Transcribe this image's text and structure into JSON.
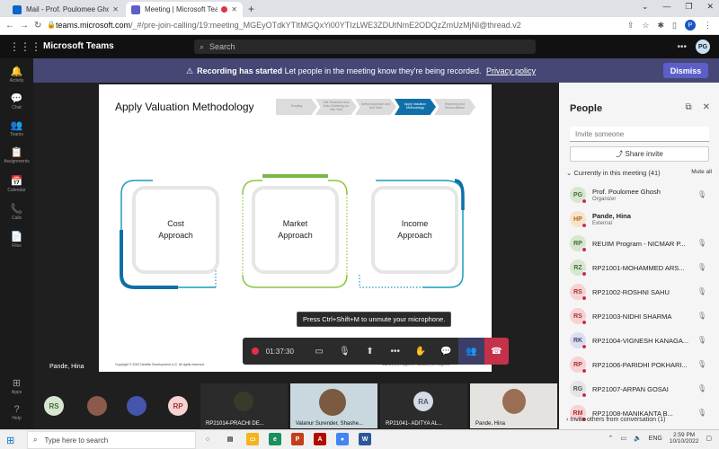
{
  "browser": {
    "tabs": [
      {
        "title": "Mail - Prof. Poulomee Ghosh - O",
        "active": false
      },
      {
        "title": "Meeting | Microsoft Teams",
        "active": true
      }
    ],
    "url_host": "teams.microsoft.com",
    "url_path": "/_#/pre-join-calling/19:meeting_MGEyOTdkYTItMGQxYi00YTIzLWE3ZDUtNmE2ODQzZmUzMjNl@thread.v2",
    "profile_initial": "P"
  },
  "teams": {
    "app_name": "Microsoft Teams",
    "search_placeholder": "Search",
    "user_initials": "PG"
  },
  "rail": [
    {
      "icon": "bell-icon",
      "glyph": "🔔",
      "label": "Activity"
    },
    {
      "icon": "chat-icon",
      "glyph": "💬",
      "label": "Chat"
    },
    {
      "icon": "teams-icon",
      "glyph": "👥",
      "label": "Teams"
    },
    {
      "icon": "assignments-icon",
      "glyph": "📋",
      "label": "Assignments"
    },
    {
      "icon": "calendar-icon",
      "glyph": "📅",
      "label": "Calendar"
    },
    {
      "icon": "calls-icon",
      "glyph": "📞",
      "label": "Calls"
    },
    {
      "icon": "files-icon",
      "glyph": "📄",
      "label": "Files"
    },
    {
      "icon": "apps-icon",
      "glyph": "⊞",
      "label": "Apps"
    },
    {
      "icon": "help-icon",
      "glyph": "?",
      "label": "Help"
    }
  ],
  "banner": {
    "bold": "Recording has started",
    "text": "Let people in the meeting know they're being recorded.",
    "link": "Privacy policy",
    "dismiss": "Dismiss"
  },
  "slide": {
    "title": "Apply Valuation Methodology",
    "steps": [
      "Scoping",
      "Site Research and Data Gathering on Site Visit",
      "Select Approach and Use Data",
      "Apply Valuation Methodology",
      "Reporting and Reconciliation"
    ],
    "approaches": [
      {
        "line1": "Cost",
        "line2": "Approach",
        "color": "#0f6fa8"
      },
      {
        "line1": "Market",
        "line2": "Approach",
        "color": "#8cc63f"
      },
      {
        "line1": "Income",
        "line2": "Approach",
        "color": "#1a9ac0"
      }
    ],
    "footer_left": "Copyright © 2022 Deloitte Development LLC. All rights reserved.",
    "footer_right": "Machinery & Equipment Valuation  |  An Insight     21"
  },
  "stage": {
    "presenter": "Pande, Hina",
    "tooltip": "Press Ctrl+Shift+M to unmute your microphone.",
    "timer": "01:37:30"
  },
  "controls": [
    {
      "icon": "camera-off-icon",
      "glyph": "▭"
    },
    {
      "icon": "mic-off-icon",
      "glyph": "🎙"
    },
    {
      "icon": "share-screen-icon",
      "glyph": "⬆"
    },
    {
      "icon": "more-icon",
      "glyph": "•••"
    },
    {
      "icon": "raise-hand-icon",
      "glyph": "✋"
    },
    {
      "icon": "chat-icon",
      "glyph": "💬"
    },
    {
      "icon": "people-icon",
      "glyph": "👥"
    }
  ],
  "strip": {
    "avatars": [
      {
        "initials": "RS",
        "bg": "#d6e6cf",
        "fg": "#4a6b3c"
      },
      {
        "initials": "RP",
        "bg": "#f6d2d2",
        "fg": "#a33"
      }
    ],
    "tiles": [
      {
        "name": "RP21014-PRACHI DE..."
      },
      {
        "name": "Valanur Surender, Shashe..."
      },
      {
        "name": "RP21041- ADITYA AL..."
      },
      {
        "name": "Pande, Hina"
      }
    ],
    "ra_initials": "RA"
  },
  "people": {
    "title": "People",
    "invite_placeholder": "Invite someone",
    "share_invite": "Share invite",
    "section": "Currently in this meeting (41)",
    "mute_all": "Mute all",
    "participants": [
      {
        "initials": "PG",
        "name": "Prof. Poulomee Ghosh",
        "role": "Organizer",
        "bg": "#d6e6cf",
        "fg": "#4a6b3c",
        "bold": false
      },
      {
        "initials": "HP",
        "name": "Pande, Hina",
        "role": "External",
        "bg": "#f9e3c8",
        "fg": "#b2662a",
        "bold": true
      },
      {
        "initials": "RP",
        "name": "REUIM Program - NICMAR P...",
        "role": "",
        "bg": "#d6e6cf",
        "fg": "#4a6b3c",
        "bold": false
      },
      {
        "initials": "RZ",
        "name": "RP21001-MOHAMMED ARS...",
        "role": "",
        "bg": "#d6e6cf",
        "fg": "#4a6b3c",
        "bold": false
      },
      {
        "initials": "RS",
        "name": "RP21002-ROSHNI SAHU",
        "role": "",
        "bg": "#f6d2d2",
        "fg": "#a33",
        "bold": false
      },
      {
        "initials": "RS",
        "name": "RP21003-NIDHI SHARMA",
        "role": "",
        "bg": "#f6d2d2",
        "fg": "#a33",
        "bold": false
      },
      {
        "initials": "RK",
        "name": "RP21004-VIGNESH KANAGA...",
        "role": "",
        "bg": "#dcdcf4",
        "fg": "#464775",
        "bold": false
      },
      {
        "initials": "RP",
        "name": "RP21006-PARIDHI POKHARI...",
        "role": "",
        "bg": "#f6d2d2",
        "fg": "#a33",
        "bold": false
      },
      {
        "initials": "RG",
        "name": "RP21007-ARPAN GOSAI",
        "role": "",
        "bg": "#e4e4e4",
        "fg": "#555",
        "bold": false
      },
      {
        "initials": "RM",
        "name": "RP21008-MANIKANTA B...",
        "role": "",
        "bg": "#f6d2d2",
        "fg": "#a33",
        "bold": false
      }
    ],
    "invite_others": "Invite others from conversation (1)"
  },
  "taskbar": {
    "search": "Type here to search",
    "lang": "ENG",
    "time": "2:59 PM",
    "date": "10/10/2022"
  }
}
